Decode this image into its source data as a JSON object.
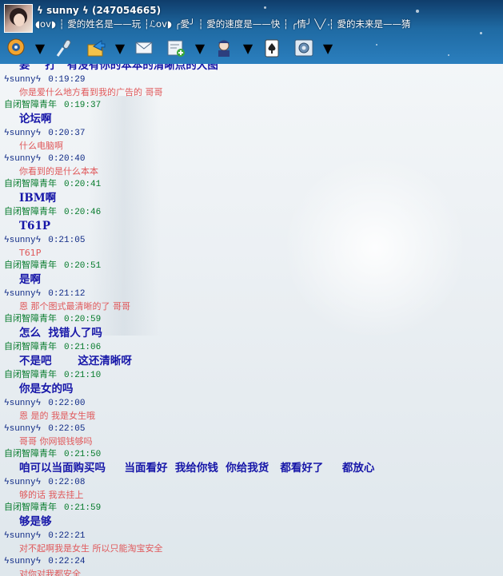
{
  "profile": {
    "nickname": "ϟ sunny ϟ (247054665)",
    "signature": "◖ov◗ ┆ 愛的姓名是——玩   ┆ℒov◗   ╭愛╯ ┆ 愛的速度是——快   ┆ ╭情╯   ╲╱ ┆ 愛的未来是——猜"
  },
  "toolbar": {
    "items": [
      {
        "icon": "webcam-icon"
      },
      {
        "icon": "microphone-icon"
      },
      {
        "icon": "file-transfer-icon"
      },
      {
        "icon": "email-icon"
      },
      {
        "icon": "add-app-icon"
      },
      {
        "icon": "assistant-icon"
      },
      {
        "icon": "card-game-icon"
      },
      {
        "icon": "settings-icon"
      }
    ]
  },
  "messages": [
    {
      "sender": "",
      "time": "",
      "text": "要    打   有没有你的本本的清晰点的大图",
      "style": "bold",
      "color": "green"
    },
    {
      "sender": "ϟsunnyϟ",
      "time": "0:19:29",
      "text": "你是爱什么地方看到我的广告的 哥哥",
      "style": "small",
      "color": "blue"
    },
    {
      "sender": "自闭智障青年",
      "time": "0:19:37",
      "text": "论坛啊",
      "style": "bold",
      "color": "green"
    },
    {
      "sender": "ϟsunnyϟ",
      "time": "0:20:37",
      "text": "什么电脑啊",
      "style": "small",
      "color": "blue"
    },
    {
      "sender": "ϟsunnyϟ",
      "time": "0:20:40",
      "text": "你看到的是什么本本",
      "style": "small",
      "color": "blue"
    },
    {
      "sender": "自闭智障青年",
      "time": "0:20:41",
      "text": "IBM啊",
      "style": "bold",
      "color": "green"
    },
    {
      "sender": "自闭智障青年",
      "time": "0:20:46",
      "text": "T61P",
      "style": "bold",
      "color": "green"
    },
    {
      "sender": "ϟsunnyϟ",
      "time": "0:21:05",
      "text": "T61P",
      "style": "small",
      "color": "blue"
    },
    {
      "sender": "自闭智障青年",
      "time": "0:20:51",
      "text": "是啊",
      "style": "bold",
      "color": "green"
    },
    {
      "sender": "ϟsunnyϟ",
      "time": "0:21:12",
      "text": "恩 那个图式最清晰的了 哥哥",
      "style": "small",
      "color": "blue"
    },
    {
      "sender": "自闭智障青年",
      "time": "0:20:59",
      "text": "怎么  找错人了吗",
      "style": "bold",
      "color": "green"
    },
    {
      "sender": "自闭智障青年",
      "time": "0:21:06",
      "text": "不是吧       这还清晰呀",
      "style": "bold",
      "color": "green"
    },
    {
      "sender": "自闭智障青年",
      "time": "0:21:10",
      "text": "你是女的吗",
      "style": "bold",
      "color": "green"
    },
    {
      "sender": "ϟsunnyϟ",
      "time": "0:22:00",
      "text": "恩 是的 我是女生哦",
      "style": "small",
      "color": "blue"
    },
    {
      "sender": "ϟsunnyϟ",
      "time": "0:22:05",
      "text": "哥哥 你网银钱够吗",
      "style": "small",
      "color": "blue"
    },
    {
      "sender": "自闭智障青年",
      "time": "0:21:50",
      "text": "咱可以当面购买吗     当面看好  我给你钱  你给我货   都看好了     都放心",
      "style": "bold",
      "color": "green"
    },
    {
      "sender": "ϟsunnyϟ",
      "time": "0:22:08",
      "text": "够的话 我去挂上",
      "style": "small",
      "color": "blue"
    },
    {
      "sender": "自闭智障青年",
      "time": "0:21:59",
      "text": "够是够",
      "style": "bold",
      "color": "green"
    },
    {
      "sender": "ϟsunnyϟ",
      "time": "0:22:21",
      "text": "对不起啊我是女生 所以只能淘宝安全",
      "style": "small",
      "color": "blue"
    },
    {
      "sender": "ϟsunnyϟ",
      "time": "0:22:24",
      "text": "对你对我都安全",
      "style": "small",
      "color": "blue"
    }
  ]
}
